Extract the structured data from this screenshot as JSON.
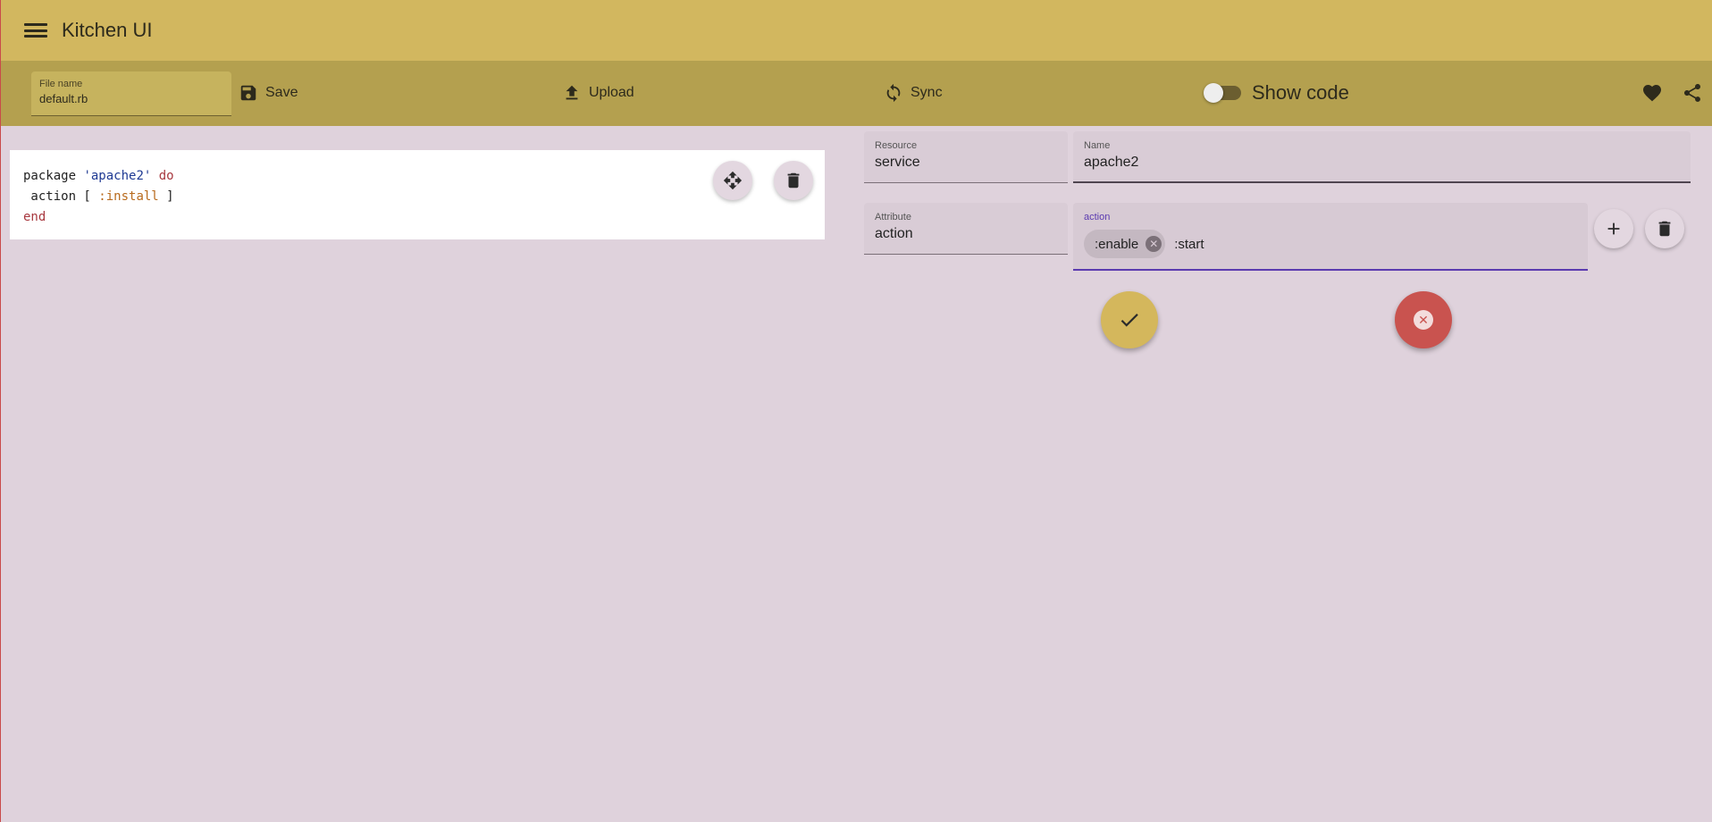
{
  "app": {
    "title": "Kitchen UI"
  },
  "toolbar": {
    "filename_label": "File name",
    "filename_value": "default.rb",
    "save_label": "Save",
    "upload_label": "Upload",
    "sync_label": "Sync",
    "show_code_label": "Show code",
    "show_code_on": false
  },
  "code": {
    "lines": [
      {
        "text1": "package ",
        "str": "'apache2'",
        "kw": " do"
      },
      {
        "text": " action [ ",
        "sym": ":install",
        "end": " ]"
      },
      {
        "kw": "end"
      }
    ]
  },
  "form": {
    "resource_label": "Resource",
    "resource_value": "service",
    "name_label": "Name",
    "name_value": "apache2",
    "attribute_label": "Attribute",
    "attribute_value": "action",
    "action_label": "action",
    "action_chips": [
      ":enable"
    ],
    "action_input_value": ":start"
  },
  "colors": {
    "appbar": "#d2b75f",
    "toolbar": "#b4a04f",
    "background": "#dfd2dc",
    "focus": "#5b3bb0",
    "confirm": "#d4b75c",
    "cancel": "#c9534f"
  }
}
